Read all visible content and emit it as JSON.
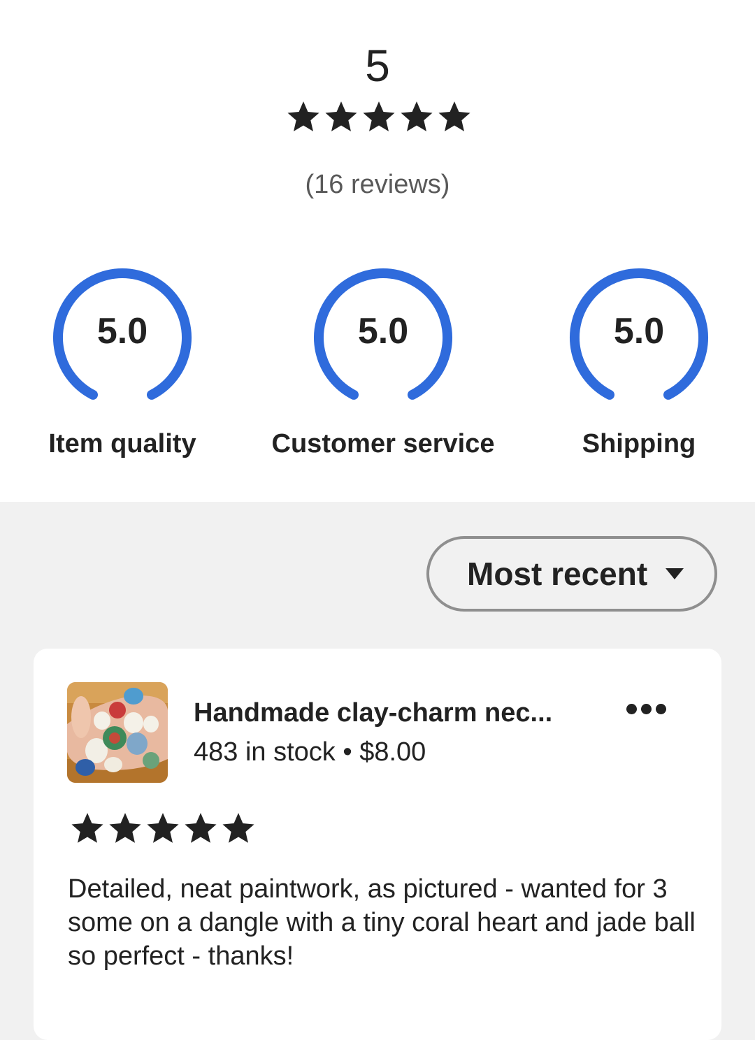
{
  "summary": {
    "average": "5",
    "stars": 5,
    "review_count": "(16 reviews)",
    "accent_color": "#2f6bdc",
    "metrics": [
      {
        "value": "5.0",
        "label": "Item quality"
      },
      {
        "value": "5.0",
        "label": "Customer service"
      },
      {
        "value": "5.0",
        "label": "Shipping"
      }
    ]
  },
  "sort": {
    "label": "Most recent",
    "icon": "caret-down-icon"
  },
  "review": {
    "listing_title": "Handmade clay-charm nec...",
    "listing_meta": "483 in stock • $8.00",
    "more_icon": "ellipsis-icon",
    "stars": 5,
    "text": "Detailed, neat paintwork, as pictured - wanted for 3 some on a dangle with a tiny coral heart and jade ball so perfect - thanks!"
  }
}
